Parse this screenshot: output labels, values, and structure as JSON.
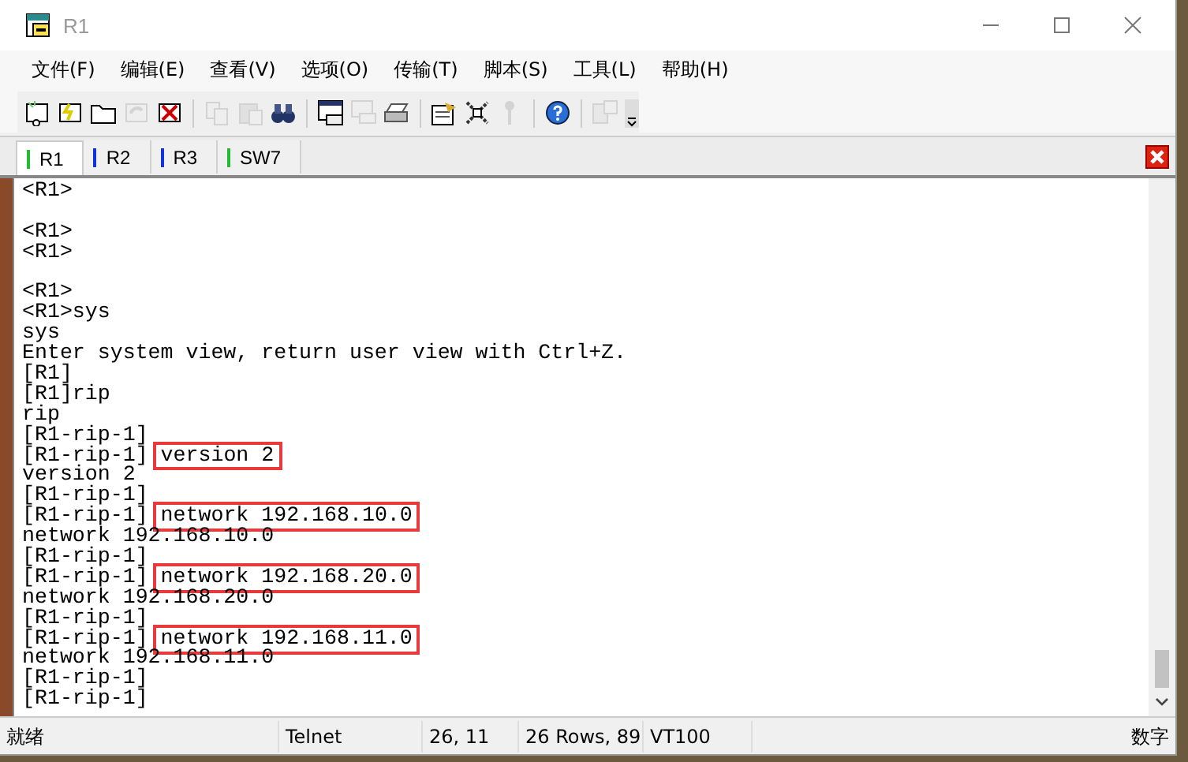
{
  "window": {
    "title": "R1"
  },
  "menu": [
    "文件(F)",
    "编辑(E)",
    "查看(V)",
    "选项(O)",
    "传输(T)",
    "脚本(S)",
    "工具(L)",
    "帮助(H)"
  ],
  "toolbar": [
    {
      "kind": "connect",
      "disabled": false
    },
    {
      "kind": "quick-connect",
      "disabled": false
    },
    {
      "kind": "folder",
      "disabled": false
    },
    {
      "kind": "reconnect",
      "disabled": true
    },
    {
      "kind": "disconnect",
      "disabled": false
    },
    {
      "kind": "separator"
    },
    {
      "kind": "copy",
      "disabled": true
    },
    {
      "kind": "paste",
      "disabled": true
    },
    {
      "kind": "find",
      "disabled": false
    },
    {
      "kind": "separator"
    },
    {
      "kind": "print-window",
      "disabled": false
    },
    {
      "kind": "print-screen",
      "disabled": true
    },
    {
      "kind": "printer",
      "disabled": false
    },
    {
      "kind": "separator"
    },
    {
      "kind": "options",
      "disabled": false
    },
    {
      "kind": "tools",
      "disabled": false
    },
    {
      "kind": "key",
      "disabled": true
    },
    {
      "kind": "separator"
    },
    {
      "kind": "help",
      "disabled": false
    },
    {
      "kind": "separator"
    },
    {
      "kind": "window",
      "disabled": true
    }
  ],
  "tabs": [
    {
      "label": "R1",
      "selected": true,
      "color": "#22bb33"
    },
    {
      "label": "R2",
      "selected": false,
      "color": "#1133dd"
    },
    {
      "label": "R3",
      "selected": false,
      "color": "#1133dd"
    },
    {
      "label": "SW7",
      "selected": false,
      "color": "#22bb33"
    }
  ],
  "terminal": {
    "lines": [
      {
        "kind": "output",
        "text": "<R1>"
      },
      {
        "kind": "blank"
      },
      {
        "kind": "output",
        "text": "<R1>"
      },
      {
        "kind": "output",
        "text": "<R1>"
      },
      {
        "kind": "blank"
      },
      {
        "kind": "output",
        "text": "<R1>"
      },
      {
        "kind": "output",
        "text": "<R1>sys"
      },
      {
        "kind": "output",
        "text": "sys"
      },
      {
        "kind": "output",
        "text": "Enter system view, return user view with Ctrl+Z."
      },
      {
        "kind": "output",
        "text": "[R1]"
      },
      {
        "kind": "output",
        "text": "[R1]rip"
      },
      {
        "kind": "output",
        "text": "rip"
      },
      {
        "kind": "output",
        "text": "[R1-rip-1]"
      },
      {
        "kind": "command",
        "prompt": "[R1-rip-1]",
        "text": "version 2",
        "highlighted": true
      },
      {
        "kind": "output",
        "text": "version 2"
      },
      {
        "kind": "output",
        "text": "[R1-rip-1]"
      },
      {
        "kind": "command",
        "prompt": "[R1-rip-1]",
        "text": "network 192.168.10.0",
        "highlighted": true
      },
      {
        "kind": "output",
        "text": "network 192.168.10.0"
      },
      {
        "kind": "output",
        "text": "[R1-rip-1]"
      },
      {
        "kind": "command",
        "prompt": "[R1-rip-1]",
        "text": "network 192.168.20.0",
        "highlighted": true
      },
      {
        "kind": "output",
        "text": "network 192.168.20.0"
      },
      {
        "kind": "output",
        "text": "[R1-rip-1]"
      },
      {
        "kind": "command",
        "prompt": "[R1-rip-1]",
        "text": "network 192.168.11.0",
        "highlighted": true
      },
      {
        "kind": "output",
        "text": "network 192.168.11.0"
      },
      {
        "kind": "output",
        "text": "[R1-rip-1]"
      },
      {
        "kind": "output",
        "text": "[R1-rip-1]"
      }
    ]
  },
  "status_bar": [
    "就绪",
    "Telnet",
    "26,  11",
    "26 Rows,  89",
    "VT100",
    "数字"
  ]
}
